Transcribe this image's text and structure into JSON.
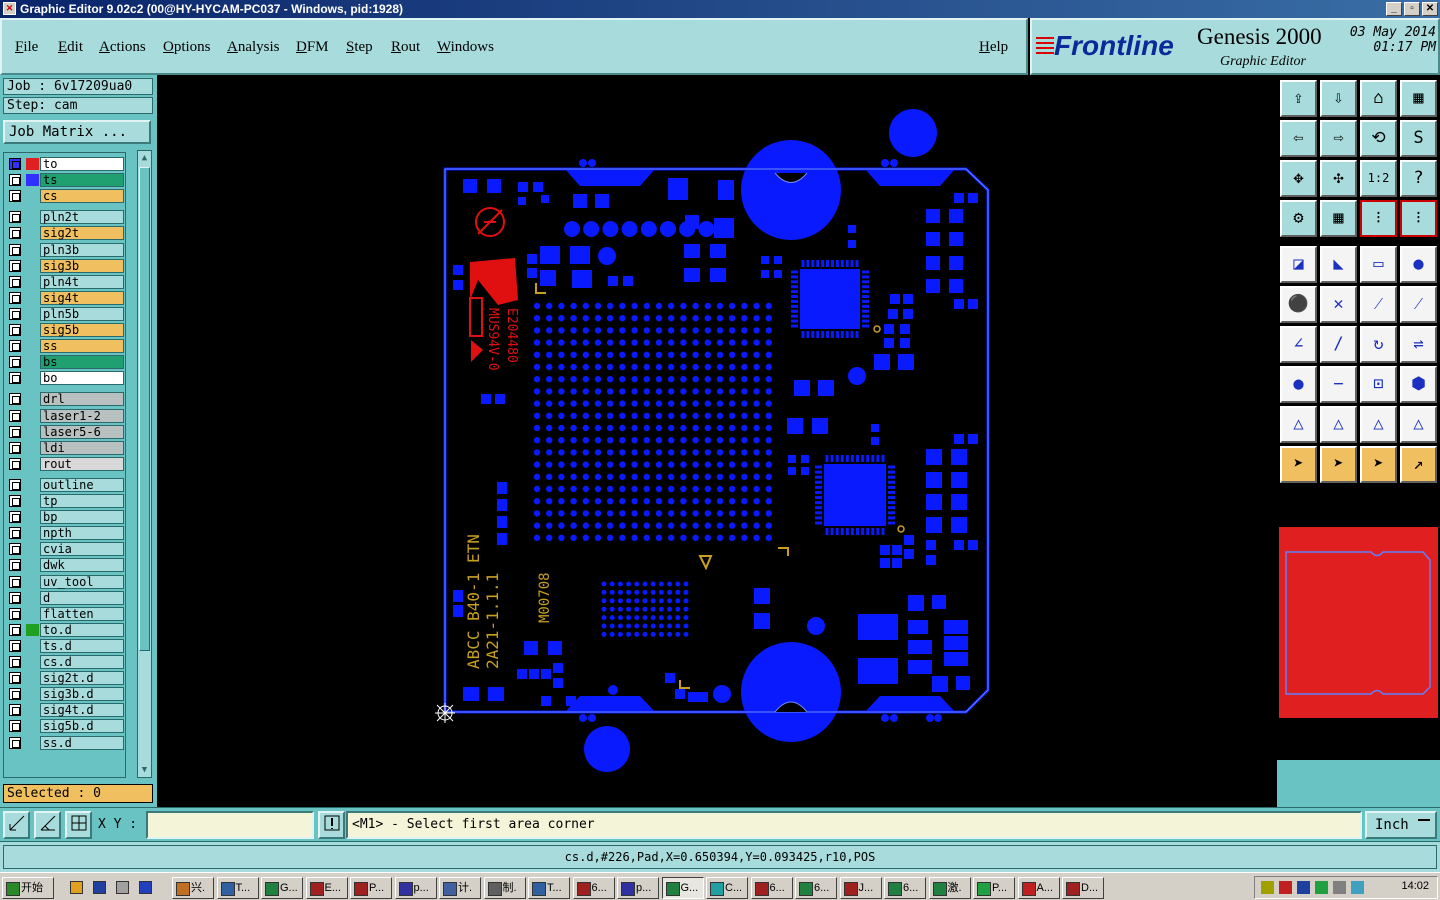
{
  "window": {
    "title": "Graphic Editor 9.02c2 (00@HY-HYCAM-PC037 - Windows, pid:1928)"
  },
  "menu": [
    "File",
    "Edit",
    "Actions",
    "Options",
    "Analysis",
    "DFM",
    "Step",
    "Rout",
    "Windows"
  ],
  "help_label": "Help",
  "logo": {
    "brand": "Frontline",
    "product": "Genesis 2000",
    "subtitle": "Graphic Editor",
    "date": "03 May 2014",
    "time": "01:17 PM"
  },
  "job": {
    "job_line": "Job : 6v17209ua0",
    "step_line": "Step: cam",
    "matrix_button": "Job Matrix ..."
  },
  "layers": [
    {
      "name": "to",
      "bg": "#ffffff",
      "color": "#e02020",
      "box": "#3030ff"
    },
    {
      "name": "ts",
      "bg": "#20a070",
      "color": "#3030ff"
    },
    {
      "name": "cs",
      "bg": "#f0c060"
    },
    {
      "name": "pln2t",
      "bg": "#a8dcdc"
    },
    {
      "name": "sig2t",
      "bg": "#f0c060"
    },
    {
      "name": "pln3b",
      "bg": "#a8dcdc"
    },
    {
      "name": "sig3b",
      "bg": "#f0c060"
    },
    {
      "name": "pln4t",
      "bg": "#a8dcdc"
    },
    {
      "name": "sig4t",
      "bg": "#f0c060"
    },
    {
      "name": "pln5b",
      "bg": "#a8dcdc"
    },
    {
      "name": "sig5b",
      "bg": "#f0c060"
    },
    {
      "name": "ss",
      "bg": "#f0c060"
    },
    {
      "name": "bs",
      "bg": "#20a070"
    },
    {
      "name": "bo",
      "bg": "#ffffff"
    },
    {
      "name": "drl",
      "bg": "#b8c0c0"
    },
    {
      "name": "laser1-2",
      "bg": "#b8c0c0"
    },
    {
      "name": "laser5-6",
      "bg": "#b8c0c0"
    },
    {
      "name": "ldi",
      "bg": "#b8c0c0"
    },
    {
      "name": "rout",
      "bg": "#d8d8d8"
    },
    {
      "name": "outline",
      "bg": "#a8dcdc"
    },
    {
      "name": "tp",
      "bg": "#a8dcdc"
    },
    {
      "name": "bp",
      "bg": "#a8dcdc"
    },
    {
      "name": "npth",
      "bg": "#a8dcdc"
    },
    {
      "name": "cvia",
      "bg": "#a8dcdc"
    },
    {
      "name": "dwk",
      "bg": "#a8dcdc"
    },
    {
      "name": "uv_tool",
      "bg": "#a8dcdc"
    },
    {
      "name": "d",
      "bg": "#a8dcdc"
    },
    {
      "name": "flatten",
      "bg": "#a8dcdc"
    },
    {
      "name": "to.d",
      "bg": "#a8dcdc",
      "color": "#20a020"
    },
    {
      "name": "ts.d",
      "bg": "#a8dcdc"
    },
    {
      "name": "cs.d",
      "bg": "#a8dcdc"
    },
    {
      "name": "sig2t.d",
      "bg": "#a8dcdc"
    },
    {
      "name": "sig3b.d",
      "bg": "#a8dcdc"
    },
    {
      "name": "sig4t.d",
      "bg": "#a8dcdc"
    },
    {
      "name": "sig5b.d",
      "bg": "#a8dcdc"
    },
    {
      "name": "ss.d",
      "bg": "#a8dcdc"
    }
  ],
  "selected": "Selected : 0",
  "board": {
    "silkscreen_1": "ABCC B40-1 ETN",
    "silkscreen_2": "2A21-1.1.1",
    "silkscreen_3": "M00708",
    "marking_1": "E204480",
    "marking_2": "MUS94V-0"
  },
  "command": {
    "xy_label": "X Y :",
    "xy_value": "",
    "prompt": "<M1> - Select first area corner",
    "units": "Inch"
  },
  "status": "cs.d,#226,Pad,X=0.650394,Y=0.093425,r10,POS",
  "taskbar": {
    "start": "开始",
    "tasks": [
      "兴.",
      "T...",
      "G...",
      "E...",
      "P...",
      "p...",
      "计.",
      "制.",
      "T...",
      "6...",
      "p...",
      "G...",
      "C...",
      "6...",
      "6...",
      "J...",
      "6...",
      "激.",
      "P...",
      "A...",
      "D..."
    ],
    "clock": "14:02"
  },
  "colors": {
    "copper": "#0a1aff",
    "silk_red": "#e01010",
    "silk_yellow": "#c8a020",
    "panel": "#a8dcdc"
  }
}
